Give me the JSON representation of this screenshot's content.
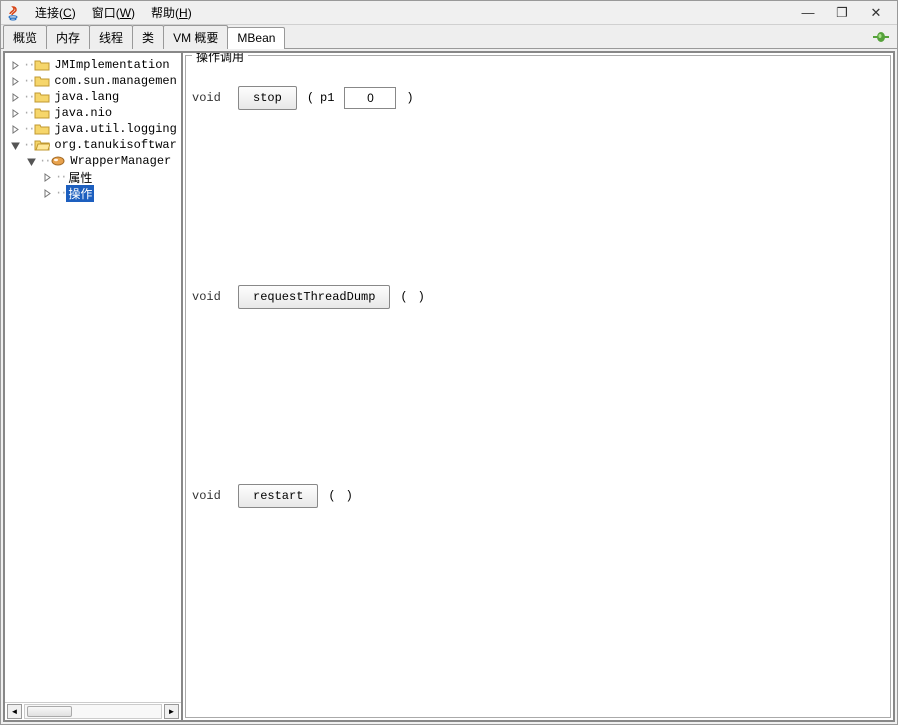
{
  "menubar": {
    "connect": "连接",
    "connect_u": "C",
    "window": "窗口",
    "window_u": "W",
    "help": "帮助",
    "help_u": "H"
  },
  "tabs": {
    "overview": "概览",
    "memory": "内存",
    "threads": "线程",
    "classes": "类",
    "vm_summary": "VM 概要",
    "mbean": "MBean"
  },
  "tree": {
    "n0": "JMImplementation",
    "n1": "com.sun.managemen",
    "n2": "java.lang",
    "n3": "java.nio",
    "n4": "java.util.logging",
    "n5": "org.tanukisoftwar",
    "n5_0": "WrapperManager",
    "n5_0_0": "属性",
    "n5_0_1": "操作"
  },
  "ops": {
    "title": "操作调用",
    "return_void": "void",
    "stop_label": "stop",
    "stop_param": "p1",
    "stop_value": "0",
    "dump_label": "requestThreadDump",
    "restart_label": "restart",
    "paren_open": "(",
    "paren_close": ")"
  }
}
